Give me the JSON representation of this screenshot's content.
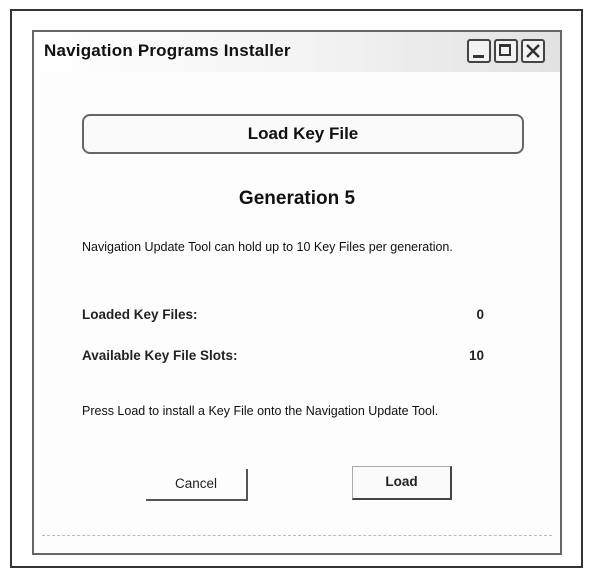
{
  "window": {
    "title": "Navigation Programs Installer",
    "minimize_icon": "minimize-icon",
    "maximize_icon": "maximize-icon",
    "close_icon": "close-icon"
  },
  "main": {
    "load_key_button": "Load Key File",
    "generation_heading": "Generation 5",
    "info_text": "Navigation Update Tool can hold up to 10 Key Files per generation.",
    "stats": [
      {
        "label": "Loaded Key Files:",
        "value": "0"
      },
      {
        "label": "Available Key File Slots:",
        "value": "10"
      }
    ],
    "instruction_text": "Press Load to install a Key File onto the Navigation Update Tool."
  },
  "buttons": {
    "cancel": "Cancel",
    "load": "Load"
  }
}
